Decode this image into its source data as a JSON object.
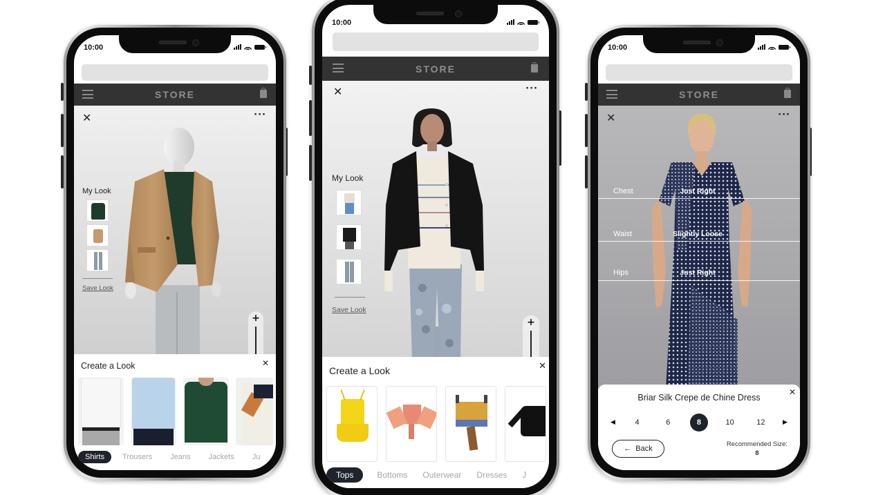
{
  "phones": [
    {
      "status_time": "10:00",
      "store_title": "STORE",
      "my_look": {
        "label": "My Look",
        "items": [
          "green-polo",
          "tan-blazer",
          "grey-trousers"
        ],
        "save_label": "Save Look"
      },
      "sheet": {
        "title": "Create a Look",
        "products": [
          "white-dress-shirt",
          "light-blue-dress-shirt",
          "green-polo-shirt",
          "printed-shirt"
        ],
        "categories": [
          "Shirts",
          "Trousers",
          "Jeans",
          "Jackets",
          "Ju"
        ],
        "active_category": "Shirts"
      }
    },
    {
      "status_time": "10:00",
      "store_title": "STORE",
      "my_look": {
        "label": "My Look",
        "items": [
          "striped-sweater-jeans",
          "black-jacket",
          "camo-pants"
        ],
        "save_label": "Save Look"
      },
      "sheet": {
        "title": "Create a Look",
        "products": [
          "yellow-cami-top",
          "printed-wrap-top",
          "printed-crop-top",
          "black-long-sleeve-top"
        ],
        "categories": [
          "Tops",
          "Bottoms",
          "Outerwear",
          "Dresses",
          "J"
        ],
        "active_category": "Tops"
      }
    },
    {
      "status_time": "10:00",
      "store_title": "STORE",
      "fit": [
        {
          "area": "Chest",
          "result": "Just Right"
        },
        {
          "area": "Waist",
          "result": "Slightly Loose"
        },
        {
          "area": "Hips",
          "result": "Just Right"
        }
      ],
      "size_panel": {
        "product_name": "Briar Silk Crepe de Chine Dress",
        "sizes": [
          "4",
          "6",
          "8",
          "10",
          "12"
        ],
        "selected_size": "8",
        "back_label": "Back",
        "recommended_label": "Recommended Size:",
        "recommended_value": "8"
      }
    }
  ],
  "colors": {
    "store_bar": "#333333",
    "active_chip": "#1f232b",
    "inactive_category": "#a6a6a6"
  }
}
